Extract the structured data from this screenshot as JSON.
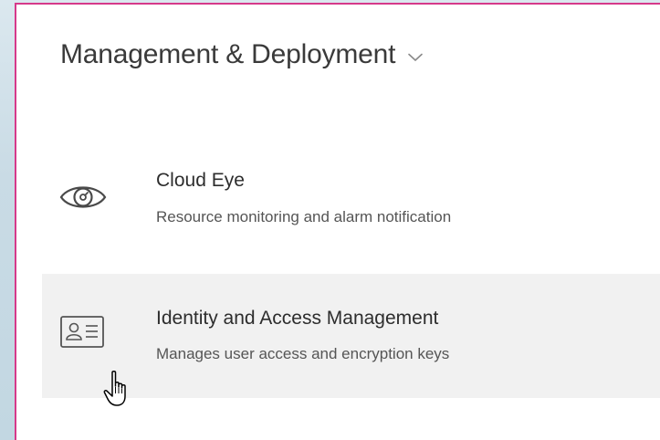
{
  "section": {
    "title": "Management & Deployment",
    "chevron_icon": "chevron-down-icon"
  },
  "services": [
    {
      "name": "Cloud Eye",
      "description": "Resource monitoring and alarm notification",
      "icon": "eye-icon"
    },
    {
      "name": "Identity and Access Management",
      "description": "Manages user access and encryption keys",
      "icon": "id-card-icon",
      "hovered": true
    }
  ],
  "colors": {
    "border_accent": "#d6398a",
    "hover_background": "#f1f1f1",
    "title_text": "#3a3a3a",
    "icon_stroke": "#555555"
  },
  "cursor": "hand-pointer-icon"
}
